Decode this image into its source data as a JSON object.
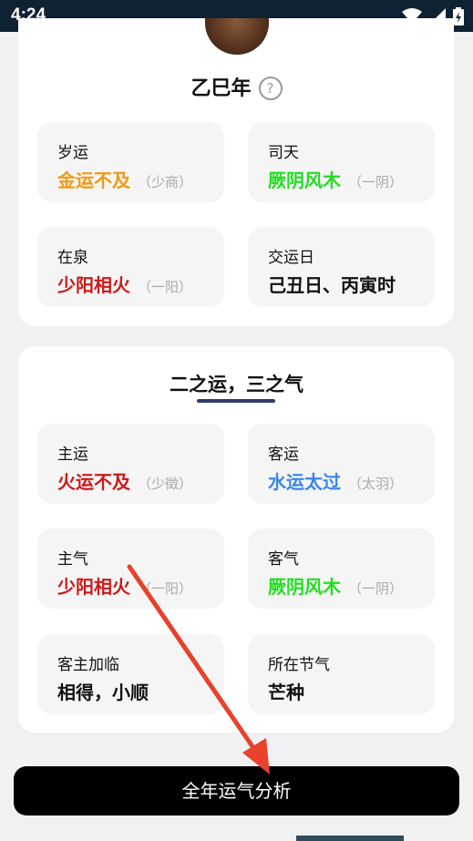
{
  "status": {
    "time": "4:24"
  },
  "year": {
    "title": "乙巳年",
    "help": "?"
  },
  "year_tiles": [
    {
      "label": "岁运",
      "value": "金运不及",
      "sub": "（少商）",
      "color": "#f09a12"
    },
    {
      "label": "司天",
      "value": "厥阴风木",
      "sub": "（一阴）",
      "color": "#22dd22"
    },
    {
      "label": "在泉",
      "value": "少阳相火",
      "sub": "（一阳）",
      "color": "#cc1a1a"
    },
    {
      "label": "交运日",
      "value": "己丑日、丙寅时",
      "sub": "",
      "color": "#111111"
    }
  ],
  "section": {
    "title": "二之运，三之气"
  },
  "section_tiles": [
    {
      "label": "主运",
      "value": "火运不及",
      "sub": "（少徵）",
      "color": "#cc1a1a"
    },
    {
      "label": "客运",
      "value": "水运太过",
      "sub": "（太羽）",
      "color": "#3a86e8"
    },
    {
      "label": "主气",
      "value": "少阳相火",
      "sub": "（一阳）",
      "color": "#cc1a1a"
    },
    {
      "label": "客气",
      "value": "厥阴风木",
      "sub": "（一阴）",
      "color": "#22dd22"
    },
    {
      "label": "客主加临",
      "value": "相得，小顺",
      "sub": "",
      "color": "#111111"
    },
    {
      "label": "所在节气",
      "value": "芒种",
      "sub": "",
      "color": "#111111"
    }
  ],
  "cta": {
    "label": "全年运气分析"
  },
  "colors": {
    "annotation_arrow": "#e8412c",
    "cta_bg": "#000000"
  }
}
